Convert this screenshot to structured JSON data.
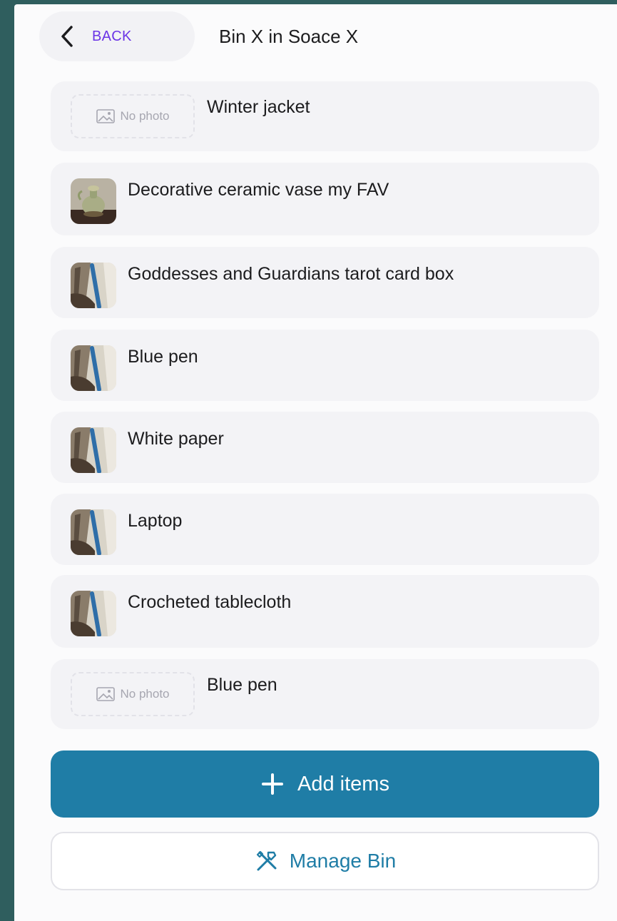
{
  "nav": {
    "back_label": "BACK",
    "title": "Bin X in Soace X"
  },
  "items": [
    {
      "label": "Winter jacket",
      "photo": "none",
      "no_photo_text": "No photo"
    },
    {
      "label": "Decorative ceramic vase my FAV",
      "photo": "vase"
    },
    {
      "label": "Goddesses and Guardians tarot card box",
      "photo": "pen-photo"
    },
    {
      "label": "Blue pen",
      "photo": "pen-photo"
    },
    {
      "label": "White paper",
      "photo": "pen-photo"
    },
    {
      "label": "Laptop",
      "photo": "pen-photo"
    },
    {
      "label": "Crocheted tablecloth",
      "photo": "pen-photo"
    },
    {
      "label": "Blue pen",
      "photo": "none",
      "no_photo_text": "No photo"
    }
  ],
  "actions": {
    "add_label": "Add items",
    "add_icon": "plus-icon",
    "manage_label": "Manage Bin",
    "manage_icon": "tools-icon"
  },
  "colors": {
    "accent": "#1f7da6",
    "back_text": "#6b34e6"
  }
}
